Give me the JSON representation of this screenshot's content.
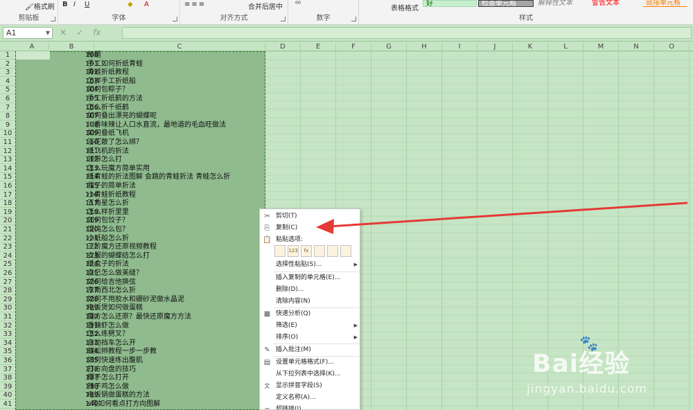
{
  "ribbon": {
    "format_painter": "格式刷",
    "bold_b": "B",
    "italic_i": "I",
    "underline_u": "U",
    "groups": {
      "clipboard": "剪贴板",
      "font": "字体",
      "alignment": "对齐方式",
      "number": "数字",
      "styles": "样式"
    },
    "merge_center": "合并后居中",
    "table_format": "表格格式",
    "style_boxes": [
      "好",
      "检查单元格",
      "解释性文本",
      "警告文本",
      "链接单元格"
    ]
  },
  "namebox": "A1",
  "fx_label": "fx",
  "columns": [
    "A",
    "B",
    "C",
    "D",
    "E",
    "F",
    "G",
    "H",
    "I",
    "J",
    "K",
    "L",
    "M",
    "N",
    "O"
  ],
  "rows": [
    {
      "n": "1",
      "num": "100",
      "txt": "标题"
    },
    {
      "n": "2",
      "num": "101",
      "txt": "手工如何折纸青蛙"
    },
    {
      "n": "3",
      "num": "102",
      "txt": "青蛙折纸教程"
    },
    {
      "n": "4",
      "num": "103",
      "txt": "怎样手工折纸船"
    },
    {
      "n": "5",
      "num": "104",
      "txt": "如何包粽子？"
    },
    {
      "n": "6",
      "num": "105",
      "txt": "手工折纸鹤的方法"
    },
    {
      "n": "7",
      "num": "106",
      "txt": "怎么折千纸鹤"
    },
    {
      "n": "8",
      "num": "107",
      "txt": "如何叠出漂亮的蝴蝶呢"
    },
    {
      "n": "9",
      "num": "108",
      "txt": "川香味辣让人口水直流，最地道的毛血旺做法"
    },
    {
      "n": "10",
      "num": "109",
      "txt": "如何叠纸飞机"
    },
    {
      "n": "11",
      "num": "110",
      "txt": "浴花散了怎么绑？"
    },
    {
      "n": "12",
      "num": "111",
      "txt": "纸飞机的折法"
    },
    {
      "n": "13",
      "num": "112",
      "txt": "领带怎么打"
    },
    {
      "n": "14",
      "num": "113",
      "txt": "怎么玩魔方简单实用"
    },
    {
      "n": "15",
      "num": "114",
      "txt": "纸青蛙的折法图解 会跳的青蛙折法 青蛙怎么折"
    },
    {
      "n": "16",
      "num": "115",
      "txt": "帽子的简单折法"
    },
    {
      "n": "17",
      "num": "116",
      "txt": "小青蛙折纸教程"
    },
    {
      "n": "18",
      "num": "117",
      "txt": "五角星怎么折"
    },
    {
      "n": "19",
      "num": "118",
      "txt": "怎么样折里里"
    },
    {
      "n": "20",
      "num": "119",
      "txt": "如何包饺子？"
    },
    {
      "n": "21",
      "num": "120",
      "txt": "馄饨怎么包？"
    },
    {
      "n": "22",
      "num": "121",
      "txt": "小纸船怎么折"
    },
    {
      "n": "23",
      "num": "122",
      "txt": "三阶魔方还原视频教程"
    },
    {
      "n": "24",
      "num": "123",
      "txt": "衣服的蝴蝶结怎么打"
    },
    {
      "n": "25",
      "num": "124",
      "txt": "纸盒子的折法"
    },
    {
      "n": "26",
      "num": "125",
      "txt": "自己怎么做美缝？"
    },
    {
      "n": "27",
      "num": "126",
      "txt": "如何给吉他换弦"
    },
    {
      "n": "28",
      "num": "127",
      "txt": "东南西北怎么折"
    },
    {
      "n": "29",
      "num": "128",
      "txt": "如何不用胶水和硼砂泥做水晶泥"
    },
    {
      "n": "30",
      "num": "129",
      "txt": "电饭煲如何做蛋糕"
    },
    {
      "n": "31",
      "num": "130",
      "txt": "魔方怎么还原？最快还原魔方方法"
    },
    {
      "n": "32",
      "num": "131",
      "txt": "香辣虾怎么做"
    },
    {
      "n": "33",
      "num": "132",
      "txt": "怎么练劈叉？"
    },
    {
      "n": "34",
      "num": "133",
      "txt": "自动挡车怎么开"
    },
    {
      "n": "35",
      "num": "134",
      "txt": "蜈蚣辫教程一步一步教"
    },
    {
      "n": "36",
      "num": "135",
      "txt": "如何快速练出腹肌"
    },
    {
      "n": "37",
      "num": "136",
      "txt": "打方向盘的技巧"
    },
    {
      "n": "38",
      "num": "137",
      "txt": "椰子怎么打开"
    },
    {
      "n": "39",
      "num": "138",
      "txt": "辣子鸡怎么做"
    },
    {
      "n": "40",
      "num": "139",
      "txt": "电饭锅做蛋糕的方法"
    },
    {
      "n": "41",
      "num": "140",
      "txt": "s弯如何看点打方向图解"
    }
  ],
  "menu": {
    "cut": "剪切(T)",
    "copy": "复制(C)",
    "paste_options": "粘贴选项:",
    "paste_icons": [
      "",
      "123",
      "fx",
      "",
      "",
      ""
    ],
    "paste_special": "选择性粘贴(S)...",
    "insert_copied": "插入复制的单元格(E)...",
    "delete": "删除(D)...",
    "clear": "清除内容(N)",
    "quick_analysis": "快速分析(Q)",
    "filter": "筛选(E)",
    "sort": "排序(O)",
    "insert_comment": "插入批注(M)",
    "format_cells": "设置单元格格式(F)...",
    "pick_list": "从下拉列表中选择(K)...",
    "phonetic": "显示拼音字段(S)",
    "define_name": "定义名称(A)...",
    "hyperlink": "超链接(I)..."
  },
  "watermark": {
    "brand": "Bai经验",
    "url": "jingyan.baidu.com"
  },
  "colors": {
    "sheet_bg": "#c6e5c4",
    "selection": "#8fbb8e",
    "arrow": "#e53935"
  }
}
